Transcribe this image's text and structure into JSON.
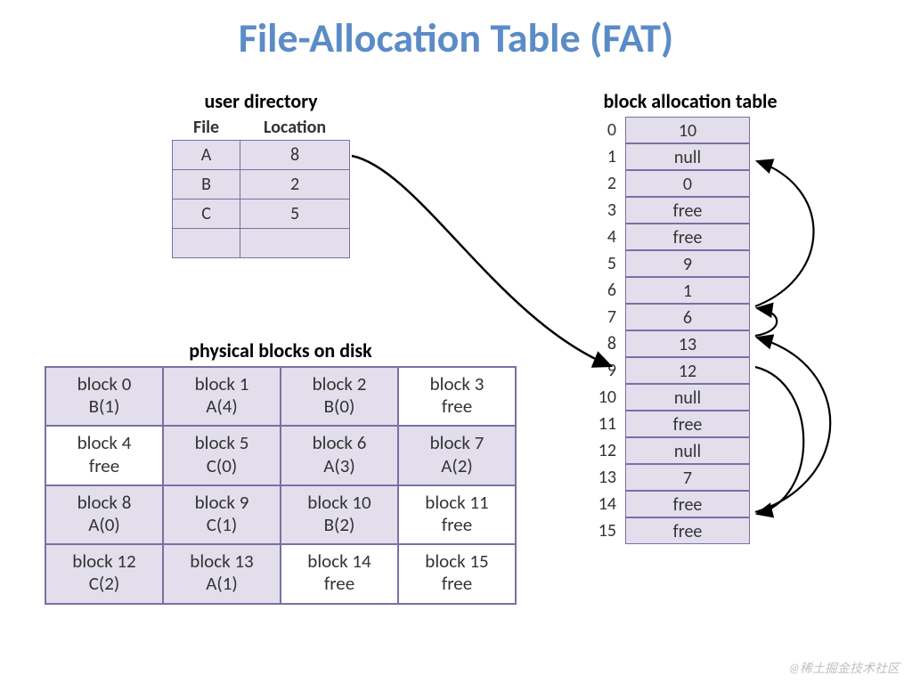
{
  "title": "File-Allocation Table (FAT)",
  "user_directory": {
    "label": "user directory",
    "headers": {
      "file": "File",
      "location": "Location"
    },
    "rows": [
      {
        "file": "A",
        "location": "8"
      },
      {
        "file": "B",
        "location": "2"
      },
      {
        "file": "C",
        "location": "5"
      },
      {
        "file": "",
        "location": ""
      }
    ]
  },
  "physical_blocks": {
    "label": "physical blocks on disk",
    "cells": [
      {
        "line1": "block 0",
        "line2": "B(1)",
        "free": false
      },
      {
        "line1": "block 1",
        "line2": "A(4)",
        "free": false
      },
      {
        "line1": "block 2",
        "line2": "B(0)",
        "free": false
      },
      {
        "line1": "block 3",
        "line2": "free",
        "free": true
      },
      {
        "line1": "block 4",
        "line2": "free",
        "free": true
      },
      {
        "line1": "block 5",
        "line2": "C(0)",
        "free": false
      },
      {
        "line1": "block 6",
        "line2": "A(3)",
        "free": false
      },
      {
        "line1": "block 7",
        "line2": "A(2)",
        "free": false
      },
      {
        "line1": "block 8",
        "line2": "A(0)",
        "free": false
      },
      {
        "line1": "block 9",
        "line2": "C(1)",
        "free": false
      },
      {
        "line1": "block 10",
        "line2": "B(2)",
        "free": false
      },
      {
        "line1": "block 11",
        "line2": "free",
        "free": true
      },
      {
        "line1": "block 12",
        "line2": "C(2)",
        "free": false
      },
      {
        "line1": "block 13",
        "line2": "A(1)",
        "free": false
      },
      {
        "line1": "block 14",
        "line2": "free",
        "free": true
      },
      {
        "line1": "block 15",
        "line2": "free",
        "free": true
      }
    ]
  },
  "block_allocation_table": {
    "label": "block allocation table",
    "entries": [
      {
        "index": "0",
        "value": "10"
      },
      {
        "index": "1",
        "value": "null"
      },
      {
        "index": "2",
        "value": "0"
      },
      {
        "index": "3",
        "value": "free"
      },
      {
        "index": "4",
        "value": "free"
      },
      {
        "index": "5",
        "value": "9"
      },
      {
        "index": "6",
        "value": "1"
      },
      {
        "index": "7",
        "value": "6"
      },
      {
        "index": "8",
        "value": "13"
      },
      {
        "index": "9",
        "value": "12"
      },
      {
        "index": "10",
        "value": "null"
      },
      {
        "index": "11",
        "value": "free"
      },
      {
        "index": "12",
        "value": "null"
      },
      {
        "index": "13",
        "value": "7"
      },
      {
        "index": "14",
        "value": "free"
      },
      {
        "index": "15",
        "value": "free"
      }
    ]
  },
  "watermark": "@稀土掘金技术社区"
}
